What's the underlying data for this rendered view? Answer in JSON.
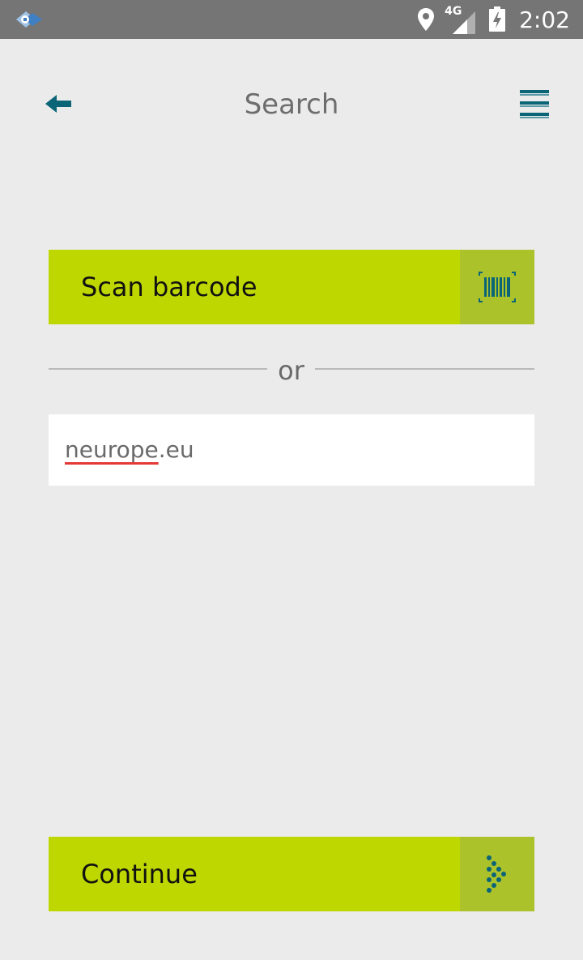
{
  "status_bar": {
    "time": "2:02",
    "network": "4G",
    "icons": [
      "app-notification-icon",
      "location-icon",
      "signal-4g-icon",
      "battery-charging-icon"
    ]
  },
  "header": {
    "title": "Search",
    "back_icon": "arrow-left-icon",
    "menu_icon": "hamburger-menu-icon"
  },
  "scan_button": {
    "label": "Scan barcode",
    "icon": "barcode-scan-icon"
  },
  "divider": {
    "text": "or"
  },
  "search": {
    "value_misspelled": "neurope",
    "value_rest": ".eu"
  },
  "continue_button": {
    "label": "Continue",
    "icon": "dotted-arrow-icon"
  },
  "colors": {
    "accent": "#bfd700",
    "accent_dark": "#abc22b",
    "icon": "#0b6577",
    "background": "#ebebeb",
    "status_bar": "#757575"
  }
}
